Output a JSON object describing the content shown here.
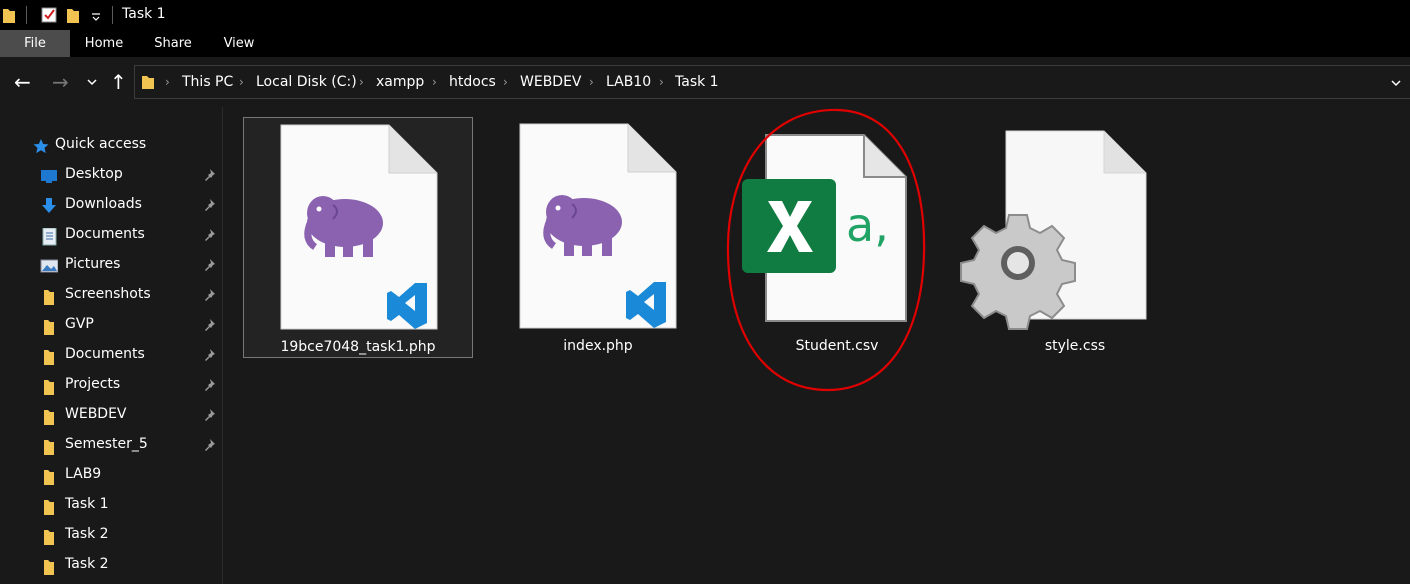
{
  "window": {
    "title": "Task 1"
  },
  "ribbon": {
    "tabs": [
      {
        "label": "File"
      },
      {
        "label": "Home"
      },
      {
        "label": "Share"
      },
      {
        "label": "View"
      }
    ]
  },
  "address": {
    "crumbs": [
      "This PC",
      "Local Disk (C:)",
      "xampp",
      "htdocs",
      "WEBDEV",
      "LAB10",
      "Task 1"
    ]
  },
  "sidebar": {
    "items": [
      {
        "label": "Quick access",
        "icon": "star-icon"
      },
      {
        "label": "Desktop",
        "icon": "desktop-icon",
        "pinned": true
      },
      {
        "label": "Downloads",
        "icon": "download-icon",
        "pinned": true
      },
      {
        "label": "Documents",
        "icon": "documents-icon",
        "pinned": true
      },
      {
        "label": "Pictures",
        "icon": "pictures-icon",
        "pinned": true
      },
      {
        "label": "Screenshots",
        "icon": "folder-icon",
        "pinned": true
      },
      {
        "label": "GVP",
        "icon": "folder-icon",
        "pinned": true
      },
      {
        "label": "Documents",
        "icon": "folder-icon",
        "pinned": true
      },
      {
        "label": "Projects",
        "icon": "folder-icon",
        "pinned": true
      },
      {
        "label": "WEBDEV",
        "icon": "folder-icon",
        "pinned": true
      },
      {
        "label": "Semester_5",
        "icon": "folder-icon",
        "pinned": true
      },
      {
        "label": "LAB9",
        "icon": "folder-icon",
        "pinned": false
      },
      {
        "label": "Task 1",
        "icon": "folder-icon",
        "pinned": false
      },
      {
        "label": "Task 2",
        "icon": "folder-icon",
        "pinned": false
      },
      {
        "label": "Task 2",
        "icon": "folder-icon",
        "pinned": false
      }
    ]
  },
  "files": [
    {
      "name": "19bce7048_task1.php",
      "type": "php",
      "selected": true
    },
    {
      "name": "index.php",
      "type": "php",
      "selected": false
    },
    {
      "name": "Student.csv",
      "type": "csv",
      "selected": false,
      "annotated": true
    },
    {
      "name": "style.css",
      "type": "css",
      "selected": false
    }
  ],
  "colors": {
    "background": "#191919",
    "folder": "#f1c452",
    "php_elephant": "#8a62b0",
    "vscode_blue": "#1a8ad8",
    "excel_green": "#107c41",
    "annotation_red": "#e00000"
  }
}
